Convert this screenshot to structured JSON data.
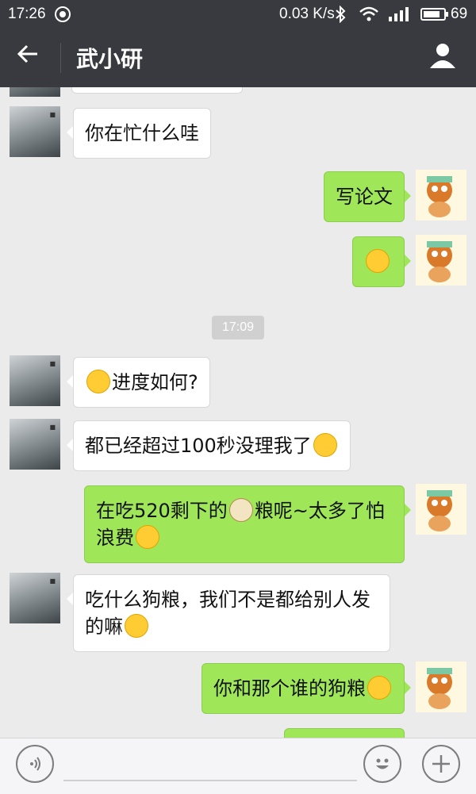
{
  "status_bar": {
    "time": "17:26",
    "network_speed": "0.03 K/s",
    "battery": "69"
  },
  "header": {
    "title": "武小研"
  },
  "messages": [
    {
      "side": "left",
      "text": "你在忙什么哇"
    },
    {
      "side": "right",
      "text": "写论文"
    },
    {
      "side": "right",
      "text": ""
    },
    {
      "side": "left",
      "text": "进度如何?"
    },
    {
      "side": "left",
      "text": "都已经超过100秒没理我了"
    },
    {
      "side": "right",
      "text_a": "在吃520剩下的",
      "text_b": "粮呢~太多了怕",
      "text_c": "浪费"
    },
    {
      "side": "left",
      "text_a": "吃什么狗粮，我们不是都给别人发",
      "text_b": "的嘛"
    },
    {
      "side": "right",
      "text": "你和那个谁的狗粮"
    }
  ],
  "timestamp": "17:09",
  "icons": {
    "back": "arrow-left-icon",
    "profile": "person-icon",
    "voice": "voice-icon",
    "emoji": "smile-icon",
    "more": "plus-icon"
  },
  "colors": {
    "header": "#393a3f",
    "bubble_right": "#9fe658",
    "bubble_left": "#ffffff",
    "background": "#ebebeb"
  }
}
